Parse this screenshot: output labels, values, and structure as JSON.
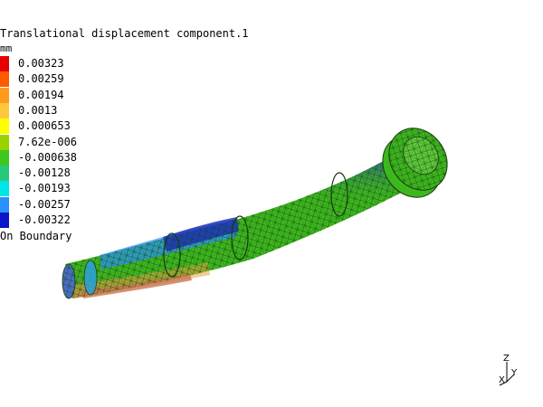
{
  "legend": {
    "title": "Translational displacement component.1",
    "unit": "mm",
    "footer": "On Boundary",
    "entries": [
      {
        "value": "0.00323",
        "color": "#e60000"
      },
      {
        "value": "0.00259",
        "color": "#ff5a00"
      },
      {
        "value": "0.00194",
        "color": "#ff9a1e"
      },
      {
        "value": "0.0013",
        "color": "#ffc83c"
      },
      {
        "value": "0.000653",
        "color": "#ffff00"
      },
      {
        "value": "7.62e-006",
        "color": "#9ad200"
      },
      {
        "value": "-0.000638",
        "color": "#3cc81e"
      },
      {
        "value": "-0.00128",
        "color": "#28c87a"
      },
      {
        "value": "-0.00193",
        "color": "#00e6e6"
      },
      {
        "value": "-0.00257",
        "color": "#2891ff"
      },
      {
        "value": "-0.00322",
        "color": "#0a14c8"
      }
    ]
  },
  "axes": {
    "z": "Z",
    "y": "Y",
    "x": "X"
  },
  "model": {
    "base_color": "#3cb81e",
    "mesh_color": "#1a3a10",
    "low_color": "#1a2ab4",
    "high_color": "#c88060"
  }
}
